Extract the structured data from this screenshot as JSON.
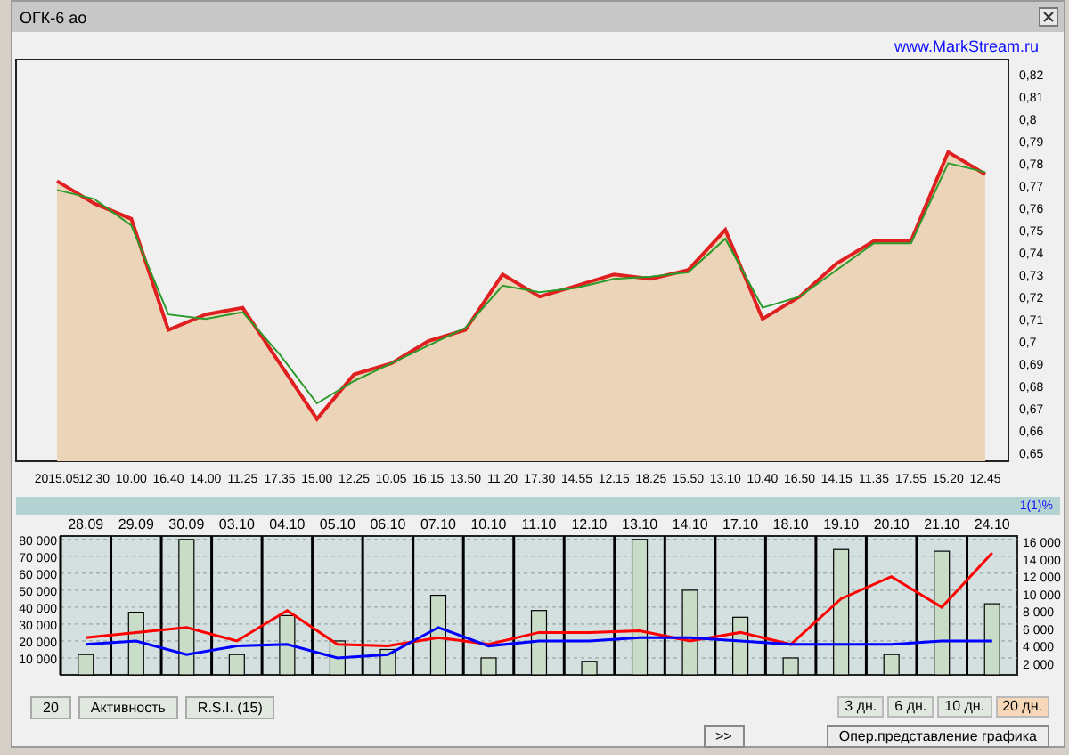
{
  "window": {
    "title": "ОГК-6 ао"
  },
  "link": "www.MarkStream.ru",
  "price_chart": {
    "chart_data": {
      "type": "area",
      "categories": [
        "2015.05",
        "12.30",
        "10.00",
        "16.40",
        "14.00",
        "11.25",
        "17.35",
        "15.00",
        "12.25",
        "10.05",
        "16.15",
        "13.50",
        "11.20",
        "17.30",
        "14.55",
        "12.15",
        "18.25",
        "15.50",
        "13.10",
        "10.40",
        "16.50",
        "14.15",
        "11.35",
        "17.55",
        "15.20",
        "12.45"
      ],
      "series": [
        {
          "type": "area",
          "color": "#e02020",
          "values": [
            0.772,
            0.762,
            0.755,
            0.705,
            0.712,
            0.715,
            0.69,
            0.665,
            0.685,
            0.69,
            0.7,
            0.705,
            0.73,
            0.72,
            0.725,
            0.73,
            0.728,
            0.732,
            0.75,
            0.71,
            0.72,
            0.735,
            0.745,
            0.745,
            0.785,
            0.775
          ]
        },
        {
          "type": "line",
          "color": "#2a9a2a",
          "values": [
            0.768,
            0.764,
            0.752,
            0.712,
            0.71,
            0.713,
            0.694,
            0.672,
            0.682,
            0.69,
            0.698,
            0.706,
            0.725,
            0.722,
            0.724,
            0.728,
            0.729,
            0.731,
            0.746,
            0.715,
            0.72,
            0.732,
            0.744,
            0.744,
            0.78,
            0.776
          ]
        }
      ],
      "ylim": [
        0.646,
        0.827
      ],
      "yticks": [
        {
          "value": 0.82,
          "label": "0,82"
        },
        {
          "value": 0.81,
          "label": "0,81"
        },
        {
          "value": 0.8,
          "label": "0,8"
        },
        {
          "value": 0.79,
          "label": "0,79"
        },
        {
          "value": 0.78,
          "label": "0,78"
        },
        {
          "value": 0.77,
          "label": "0,77"
        },
        {
          "value": 0.76,
          "label": "0,76"
        },
        {
          "value": 0.75,
          "label": "0,75"
        },
        {
          "value": 0.74,
          "label": "0,74"
        },
        {
          "value": 0.73,
          "label": "0,73"
        },
        {
          "value": 0.72,
          "label": "0,72"
        },
        {
          "value": 0.71,
          "label": "0,71"
        },
        {
          "value": 0.7,
          "label": "0,7"
        },
        {
          "value": 0.69,
          "label": "0,69"
        },
        {
          "value": 0.68,
          "label": "0,68"
        },
        {
          "value": 0.67,
          "label": "0,67"
        },
        {
          "value": 0.66,
          "label": "0,66"
        },
        {
          "value": 0.65,
          "label": "0,65"
        }
      ]
    }
  },
  "indicator_band": {
    "label": "1(1)%"
  },
  "volume_chart": {
    "right_axis_labels": [
      "16 000",
      "14 000",
      "12 000",
      "10 000",
      "8 000",
      "6 000",
      "4 000",
      "2 000"
    ],
    "chart_data": {
      "type": "bar",
      "grid": true,
      "categories": [
        "28.09",
        "29.09",
        "30.09",
        "03.10",
        "04.10",
        "05.10",
        "06.10",
        "07.10",
        "10.10",
        "11.10",
        "12.10",
        "13.10",
        "14.10",
        "17.10",
        "18.10",
        "19.10",
        "20.10",
        "21.10",
        "24.10"
      ],
      "series": [
        {
          "type": "bar",
          "color": "#c8dcc8",
          "values": [
            12000,
            37000,
            80000,
            12000,
            35000,
            20000,
            15000,
            47000,
            10000,
            38000,
            8000,
            80000,
            50000,
            34000,
            10000,
            74000,
            12000,
            73000,
            42000
          ]
        },
        {
          "type": "line",
          "color": "#ff0000",
          "values": [
            22000,
            25000,
            28000,
            20000,
            38000,
            18000,
            17000,
            22000,
            18000,
            25000,
            25000,
            26000,
            20000,
            25000,
            18000,
            45000,
            58000,
            40000,
            72000
          ]
        },
        {
          "type": "line",
          "color": "#0000ff",
          "values": [
            18000,
            20000,
            12000,
            17000,
            18000,
            10000,
            12000,
            28000,
            17000,
            20000,
            20000,
            22000,
            22000,
            20000,
            18000,
            18000,
            18000,
            20000,
            20000
          ]
        }
      ],
      "ylim": [
        0,
        82000
      ],
      "yticks": [
        {
          "value": 80000,
          "label": "80 000"
        },
        {
          "value": 70000,
          "label": "70 000"
        },
        {
          "value": 60000,
          "label": "60 000"
        },
        {
          "value": 50000,
          "label": "50 000"
        },
        {
          "value": 40000,
          "label": "40 000"
        },
        {
          "value": 30000,
          "label": "30 000"
        },
        {
          "value": 20000,
          "label": "20 000"
        },
        {
          "value": 10000,
          "label": "10 000"
        }
      ]
    }
  },
  "left_buttons": [
    "20",
    "Активность",
    "R.S.I. (15)"
  ],
  "period_tabs": [
    {
      "label": "3 дн.",
      "selected": false
    },
    {
      "label": "6 дн.",
      "selected": false
    },
    {
      "label": "10 дн.",
      "selected": false
    },
    {
      "label": "20 дн.",
      "selected": true
    }
  ],
  "buttons": [
    ">>",
    "Опер.представление графика"
  ]
}
